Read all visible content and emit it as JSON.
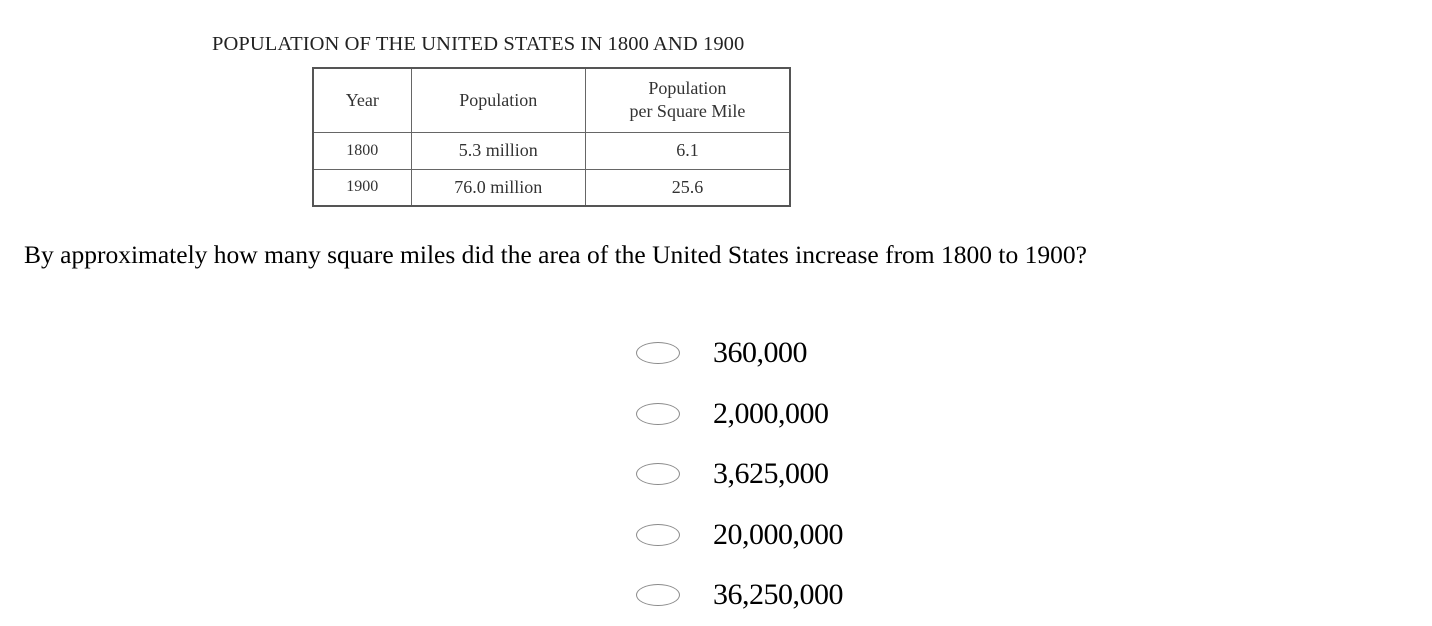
{
  "table": {
    "title": "POPULATION OF THE UNITED STATES IN 1800 AND 1900",
    "headers": {
      "year": "Year",
      "population": "Population",
      "density_line1": "Population",
      "density_line2": "per Square Mile"
    },
    "rows": [
      {
        "year": "1800",
        "population": "5.3 million",
        "density": "6.1"
      },
      {
        "year": "1900",
        "population": "76.0 million",
        "density": "25.6"
      }
    ]
  },
  "question": {
    "text": "By approximately how many square miles did the area of the United States increase from 1800 to 1900?"
  },
  "choices": [
    {
      "label": "360,000"
    },
    {
      "label": "2,000,000"
    },
    {
      "label": "3,625,000"
    },
    {
      "label": "20,000,000"
    },
    {
      "label": "36,250,000"
    }
  ]
}
